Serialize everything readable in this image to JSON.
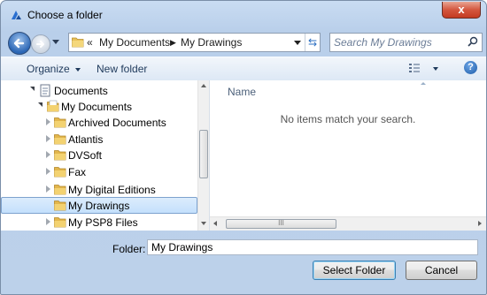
{
  "window": {
    "title": "Choose a folder",
    "close_label": "x"
  },
  "address": {
    "overflow": "«",
    "crumbs": [
      "My Documents",
      "My Drawings"
    ]
  },
  "search": {
    "placeholder": "Search My Drawings"
  },
  "toolbar": {
    "organize": "Organize",
    "new_folder": "New folder",
    "help": "?"
  },
  "tree": {
    "items": [
      {
        "label": "Documents",
        "state": "expanded",
        "icon": "library-icon"
      },
      {
        "label": "My Documents",
        "state": "expanded",
        "icon": "folder-icon"
      },
      {
        "label": "Archived Documents",
        "state": "collapsed",
        "icon": "folder-icon"
      },
      {
        "label": "Atlantis",
        "state": "collapsed",
        "icon": "folder-icon"
      },
      {
        "label": "DVSoft",
        "state": "collapsed",
        "icon": "folder-icon"
      },
      {
        "label": "Fax",
        "state": "collapsed",
        "icon": "folder-icon"
      },
      {
        "label": "My Digital Editions",
        "state": "collapsed",
        "icon": "folder-icon"
      },
      {
        "label": "My Drawings",
        "state": "none",
        "icon": "folder-icon",
        "selected": true
      },
      {
        "label": "My PSP8 Files",
        "state": "collapsed",
        "icon": "folder-icon"
      }
    ]
  },
  "list": {
    "column_name": "Name",
    "empty_text": "No items match your search.",
    "hscroll_grip": "III"
  },
  "footer": {
    "folder_label": "Folder:",
    "folder_value": "My Drawings",
    "select_button": "Select Folder",
    "cancel_button": "Cancel"
  },
  "colors": {
    "accent": "#1b5aa8",
    "selection": "#c4e0fc",
    "frame": "#bcd1ea",
    "close": "#c33a21"
  }
}
